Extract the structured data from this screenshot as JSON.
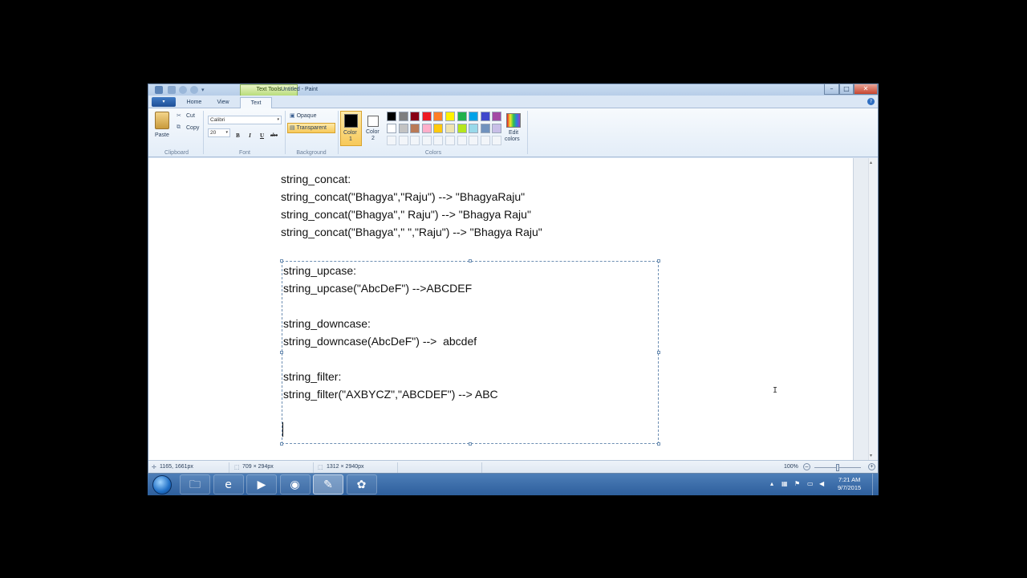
{
  "window": {
    "title": "Untitled - Paint",
    "context_tab": "Text Tools",
    "caption_buttons": {
      "minimize": "–",
      "maximize": "□",
      "close": "✕"
    }
  },
  "tabs": {
    "app_menu": "▾",
    "home": "Home",
    "view": "View",
    "text": "Text"
  },
  "clipboard": {
    "paste": "Paste",
    "cut": "Cut",
    "copy": "Copy",
    "group": "Clipboard"
  },
  "font": {
    "family": "Calibri",
    "size": "20",
    "bold": "B",
    "italic": "I",
    "underline": "U",
    "strikethrough": "abc",
    "group": "Font"
  },
  "background": {
    "opaque": "Opaque",
    "transparent": "Transparent",
    "group": "Background",
    "selected": "Transparent"
  },
  "colors": {
    "color1_label_a": "Color",
    "color1_label_b": "1",
    "color2_label_a": "Color",
    "color2_label_b": "2",
    "color1": "#000000",
    "color2": "#ffffff",
    "edit_a": "Edit",
    "edit_b": "colors",
    "group": "Colors",
    "palette_row1": [
      "#000000",
      "#7f7f7f",
      "#880015",
      "#ed1c24",
      "#ff7f27",
      "#fff200",
      "#22b14c",
      "#00a2e8",
      "#3f48cc",
      "#a349a4"
    ],
    "palette_row2": [
      "#ffffff",
      "#c3c3c3",
      "#b97a57",
      "#ffaec9",
      "#ffc90e",
      "#efe4b0",
      "#b5e61d",
      "#99d9ea",
      "#7092be",
      "#c8bfe7"
    ]
  },
  "canvas": {
    "lines_top": [
      "string_concat:",
      "string_concat(\"Bhagya\",\"Raju\") --> \"BhagyaRaju\"",
      "string_concat(\"Bhagya\",\" Raju\") --> \"Bhagya Raju\"",
      "string_concat(\"Bhagya\",\" \",\"Raju\") --> \"Bhagya Raju\""
    ],
    "lines_box": [
      "string_upcase:",
      "string_upcase(\"AbcDeF\") -->ABCDEF",
      "string_downcase:",
      "string_downcase(AbcDeF\") -->  abcdef",
      "string_filter:",
      "string_filter(\"AXBYCZ\",\"ABCDEF\") --> ABC"
    ]
  },
  "status": {
    "cursor_pos": "1165, 1661px",
    "selection_size": "709 × 294px",
    "image_size": "1312 × 2940px",
    "zoom": "100%"
  },
  "taskbar": {
    "time": "7:21 AM",
    "date": "9/7/2015",
    "apps": [
      {
        "icon": "windows-explorer",
        "glyph": "🗀"
      },
      {
        "icon": "internet-explorer",
        "glyph": "e"
      },
      {
        "icon": "media-player",
        "glyph": "▶"
      },
      {
        "icon": "chrome",
        "glyph": "◉"
      },
      {
        "icon": "paint",
        "glyph": "✎"
      },
      {
        "icon": "flower-app",
        "glyph": "✿"
      }
    ]
  }
}
